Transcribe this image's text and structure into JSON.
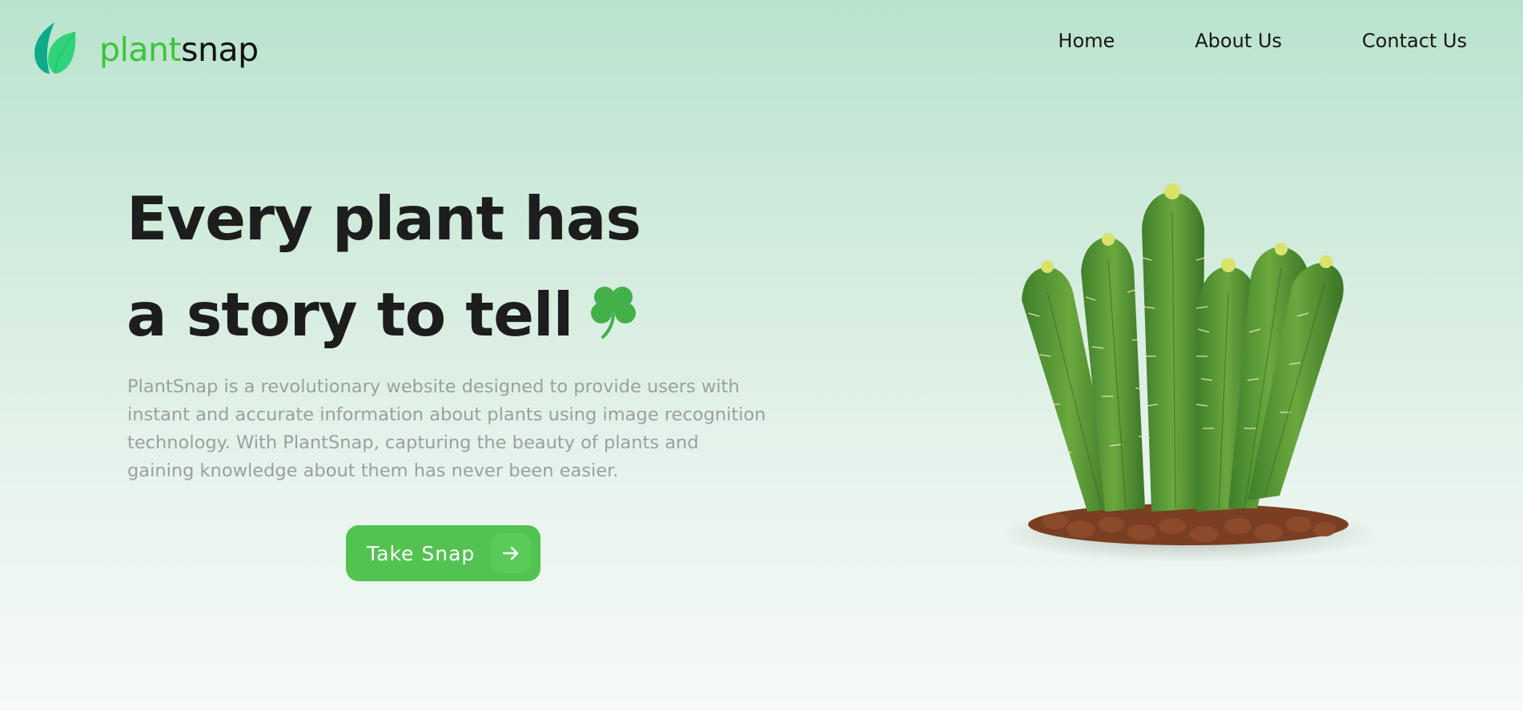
{
  "brand": {
    "name_part1": "plant",
    "name_part2": "snap",
    "accent_color": "#3dc43a",
    "logo_icon": "leaf-icon"
  },
  "nav": {
    "items": [
      {
        "label": "Home"
      },
      {
        "label": "About Us"
      },
      {
        "label": "Contact Us"
      }
    ]
  },
  "hero": {
    "title_line1": "Every plant has",
    "title_line2": "a story to tell",
    "title_icon": "clover-icon",
    "description": "PlantSnap is a revolutionary website designed to provide users with instant and accurate information about plants using image recognition technology. With PlantSnap, capturing the beauty of plants and gaining knowledge about them has never been easier.",
    "cta_label": "Take Snap",
    "cta_icon": "arrow-right-icon",
    "cta_color": "#52c350",
    "image": "cactus-image"
  }
}
